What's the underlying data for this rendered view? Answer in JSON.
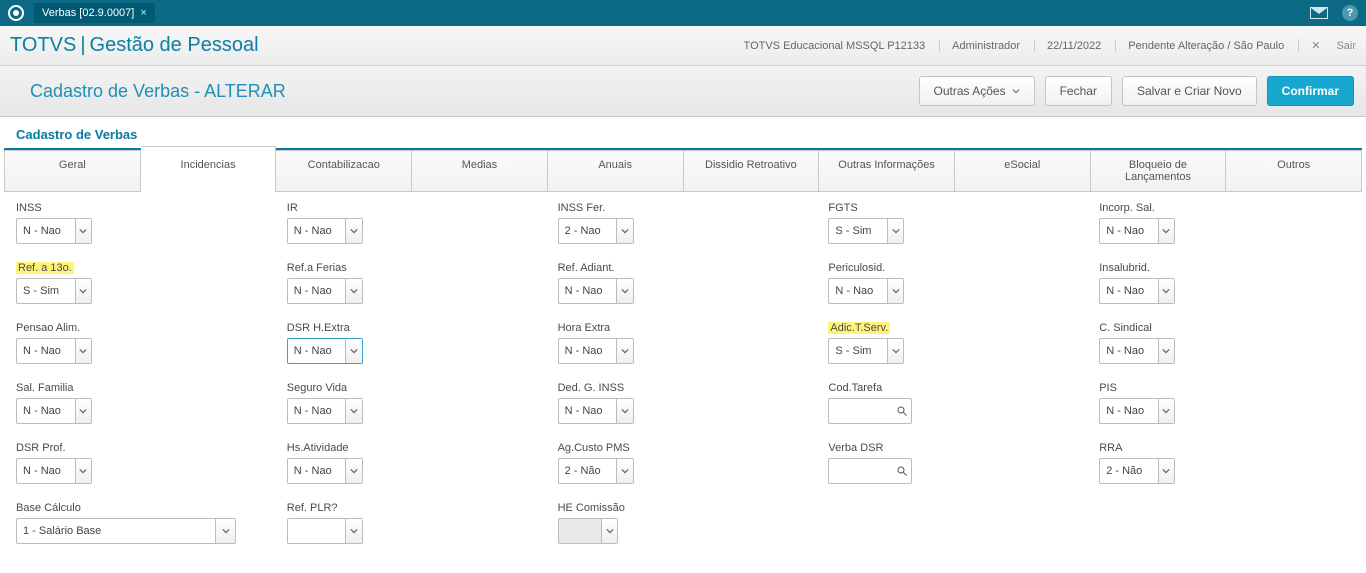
{
  "titlebar": {
    "tab_label": "Verbas [02.9.0007]"
  },
  "appbar": {
    "brand": "TOTVS",
    "app": "Gestão de Pessoal",
    "env": "TOTVS Educacional MSSQL P12133",
    "user": "Administrador",
    "date": "22/11/2022",
    "status": "Pendente Alteração / São Paulo",
    "exit": "Sair"
  },
  "actionbar": {
    "title": "Cadastro de Verbas - ALTERAR",
    "outras": "Outras Ações",
    "fechar": "Fechar",
    "salvar": "Salvar e Criar Novo",
    "confirmar": "Confirmar"
  },
  "section": "Cadastro de Verbas",
  "tabs": [
    "Geral",
    "Incidencias",
    "Contabilizacao",
    "Medias",
    "Anuais",
    "Dissidio Retroativo",
    "Outras Informações",
    "eSocial",
    "Bloqueio de Lançamentos",
    "Outros"
  ],
  "fields": {
    "inss": {
      "label": "INSS",
      "value": "N - Nao"
    },
    "ir": {
      "label": "IR",
      "value": "N - Nao"
    },
    "inss_fer": {
      "label": "INSS Fer.",
      "value": "2 - Nao"
    },
    "fgts": {
      "label": "FGTS",
      "value": "S - Sim"
    },
    "incorp": {
      "label": "Incorp. Sal.",
      "value": "N - Nao"
    },
    "ref13": {
      "label": "Ref. a 13o.",
      "value": "S - Sim"
    },
    "ref_ferias": {
      "label": "Ref.a Ferias",
      "value": "N - Nao"
    },
    "ref_adiant": {
      "label": "Ref. Adiant.",
      "value": "N - Nao"
    },
    "periculosid": {
      "label": "Periculosid.",
      "value": "N - Nao"
    },
    "insalubrid": {
      "label": "Insalubrid.",
      "value": "N - Nao"
    },
    "pensao": {
      "label": "Pensao Alim.",
      "value": "N - Nao"
    },
    "dsr_hextra": {
      "label": "DSR H.Extra",
      "value": "N - Nao"
    },
    "hora_extra": {
      "label": "Hora Extra",
      "value": "N - Nao"
    },
    "adic_tserv": {
      "label": "Adic.T.Serv.",
      "value": "S - Sim"
    },
    "c_sindical": {
      "label": "C. Sindical",
      "value": "N - Nao"
    },
    "sal_familia": {
      "label": "Sal. Familia",
      "value": "N - Nao"
    },
    "seguro_vida": {
      "label": "Seguro Vida",
      "value": "N - Nao"
    },
    "ded_g_inss": {
      "label": "Ded. G. INSS",
      "value": "N - Nao"
    },
    "cod_tarefa": {
      "label": "Cod.Tarefa",
      "value": ""
    },
    "pis": {
      "label": "PIS",
      "value": "N - Nao"
    },
    "dsr_prof": {
      "label": "DSR Prof.",
      "value": "N - Nao"
    },
    "hs_atividade": {
      "label": "Hs.Atividade",
      "value": "N - Nao"
    },
    "ag_custo": {
      "label": "Ag.Custo PMS",
      "value": "2 - Não"
    },
    "verba_dsr": {
      "label": "Verba DSR",
      "value": ""
    },
    "rra": {
      "label": "RRA",
      "value": "2 - Não"
    },
    "base_calc": {
      "label": "Base Cálculo",
      "value": "1 - Salário Base"
    },
    "ref_plr": {
      "label": "Ref. PLR?",
      "value": ""
    },
    "he_comissao": {
      "label": "HE Comissão",
      "value": ""
    }
  }
}
